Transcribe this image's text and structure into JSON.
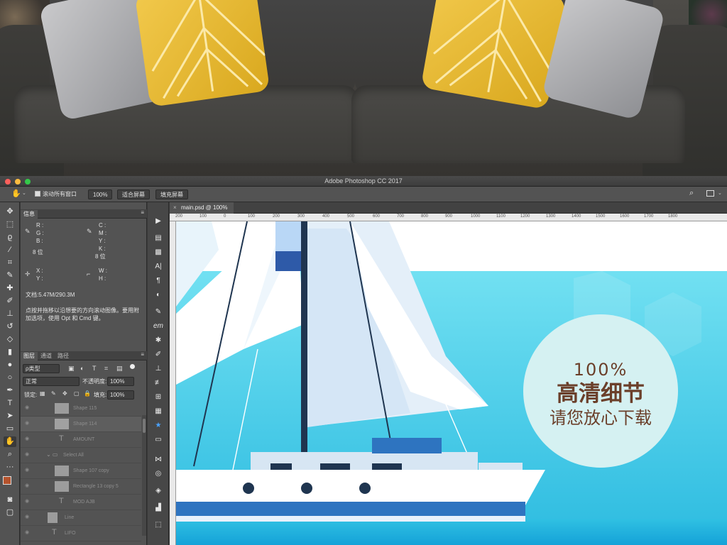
{
  "window": {
    "title": "Adobe Photoshop CC 2017",
    "traffic_lights": [
      "#fc605c",
      "#fdbc40",
      "#34c84a"
    ]
  },
  "options_bar": {
    "scroll_all_label": "滚动所有窗口",
    "zoom_value": "100%",
    "fit_screen_label": "适合屏幕",
    "fill_screen_label": "填充屏幕"
  },
  "info_panel": {
    "tab_label": "信息",
    "rgb_labels": [
      "R :",
      "G :",
      "B :"
    ],
    "cmyk_labels": [
      "C :",
      "M :",
      "Y :",
      "K :"
    ],
    "bit_left": "8 位",
    "bit_right": "8 位",
    "x_label": "X :",
    "y_label": "Y :",
    "w_label": "W :",
    "h_label": "H :",
    "doc_size": "文档:5.47M/290.3M",
    "hint_line1": "点按并拖移以沿想要的方向滚动图像。要用附",
    "hint_line2": "加选项，使用 Opt 和 Cmd 键。"
  },
  "layers_panel": {
    "tabs": [
      "图层",
      "通道",
      "路径"
    ],
    "filter_label": "ρ类型",
    "blend_mode": "正常",
    "opacity_label": "不透明度:",
    "opacity_value": "100%",
    "lock_label": "锁定:",
    "fill_label": "填充:",
    "fill_value": "100%",
    "layers": [
      {
        "name": "Shape 115",
        "kind": "shape"
      },
      {
        "name": "Shape 114",
        "kind": "shape"
      },
      {
        "name": "AMOUNT",
        "kind": "text"
      },
      {
        "name": "Select All",
        "kind": "group"
      },
      {
        "name": "Shape 107 copy",
        "kind": "shape"
      },
      {
        "name": "Rectangle 13 copy 5",
        "kind": "shape"
      },
      {
        "name": "MOD AJB",
        "kind": "text"
      },
      {
        "name": "Line",
        "kind": "shape"
      },
      {
        "name": "LIFO",
        "kind": "text"
      }
    ]
  },
  "document": {
    "tab_label": "main.psd @ 100%",
    "ruler_marks": [
      "200",
      "100",
      "0",
      "100",
      "200",
      "300",
      "400",
      "500",
      "600",
      "700",
      "800",
      "900",
      "1000",
      "1100",
      "1200",
      "1300",
      "1400",
      "1500",
      "1600",
      "1700",
      "1800"
    ]
  },
  "badge": {
    "percent": "100%",
    "line1": "高清细节",
    "line2": "请您放心下载"
  },
  "colors": {
    "foreground": "#b5532d",
    "background": "#ffffff",
    "badge_text": "#6b3f2a",
    "sea": "#38c0e0"
  },
  "icons": {
    "toolbar": [
      "move-icon",
      "marquee-icon",
      "lasso-icon",
      "magic-wand-icon",
      "crop-icon",
      "eyedropper-icon",
      "healing-icon",
      "brush-icon",
      "stamp-icon",
      "history-brush-icon",
      "eraser-icon",
      "gradient-icon",
      "blur-icon",
      "dodge-icon",
      "pen-icon",
      "type-icon",
      "path-select-icon",
      "rectangle-icon",
      "hand-icon",
      "zoom-icon"
    ]
  }
}
